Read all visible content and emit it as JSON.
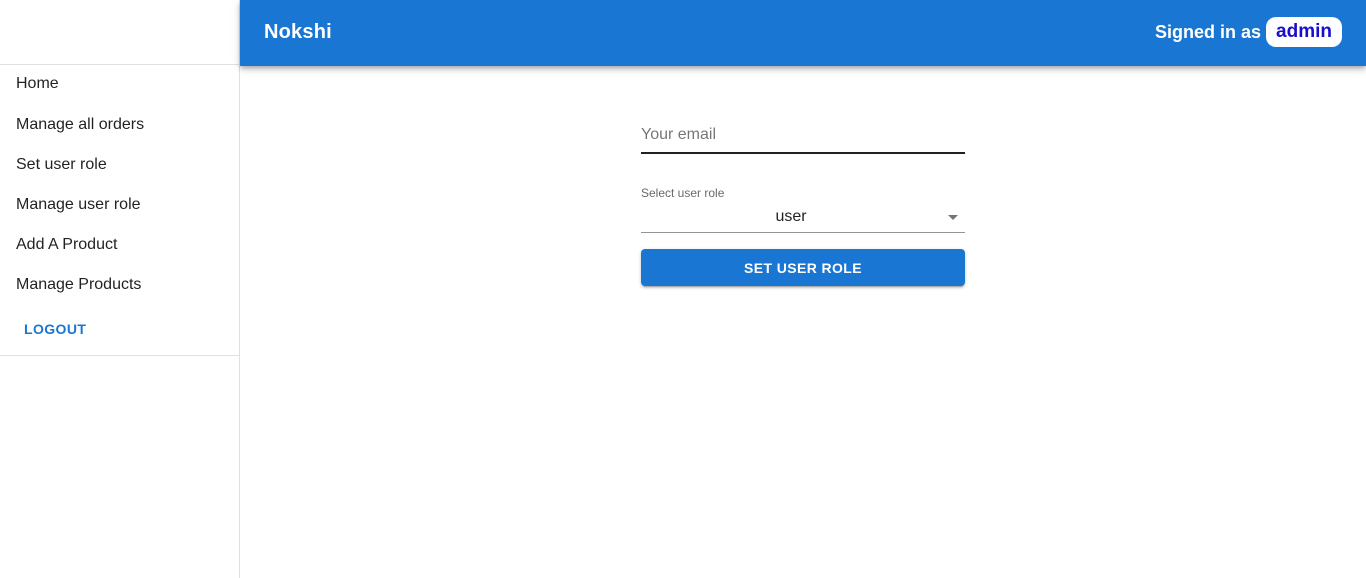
{
  "appbar": {
    "brand": "Nokshi",
    "signed_in_label": "Signed in as",
    "username": "admin"
  },
  "sidebar": {
    "items": [
      {
        "label": "Home"
      },
      {
        "label": "Manage all orders"
      },
      {
        "label": "Set user role"
      },
      {
        "label": "Manage user role"
      },
      {
        "label": "Add A Product"
      },
      {
        "label": "Manage Products"
      }
    ],
    "logout_label": "LOGOUT"
  },
  "form": {
    "email_placeholder": "Your email",
    "email_value": "",
    "role_label": "Select user role",
    "role_value": "user",
    "submit_label": "SET USER ROLE"
  },
  "colors": {
    "primary": "#1976d2",
    "chip_text": "#1a0dcc"
  }
}
